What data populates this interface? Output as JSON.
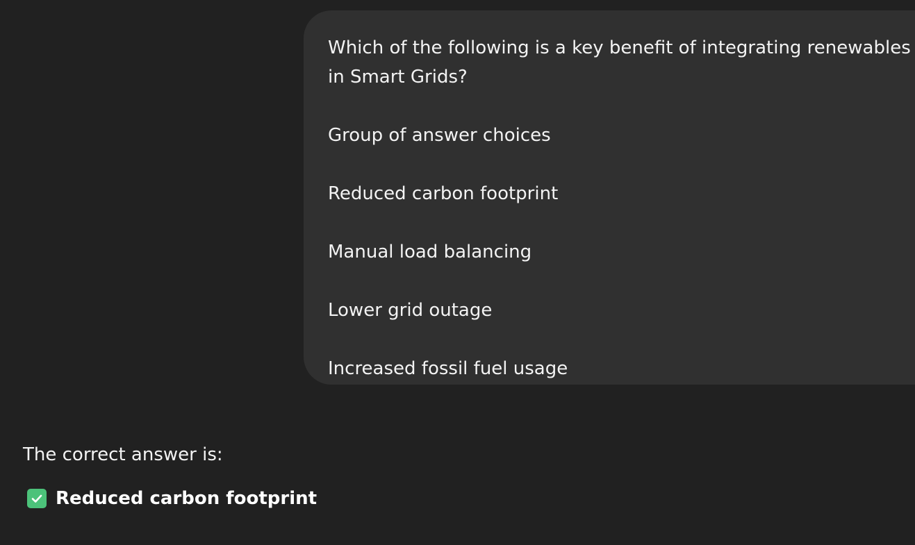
{
  "user_message": {
    "question": "Which of the following is a key benefit of integrating renewables in Smart Grids?",
    "choices_header": "Group of answer choices",
    "choices": [
      "Reduced carbon footprint",
      "Manual load balancing",
      "Lower grid outage",
      "Increased fossil fuel usage"
    ]
  },
  "assistant_message": {
    "intro": "The correct answer is:",
    "answer_icon": "check-mark-button-icon",
    "answer": "Reduced carbon footprint"
  },
  "colors": {
    "background": "#212121",
    "user_bubble": "#303030",
    "check_green": "#4cc27a"
  }
}
